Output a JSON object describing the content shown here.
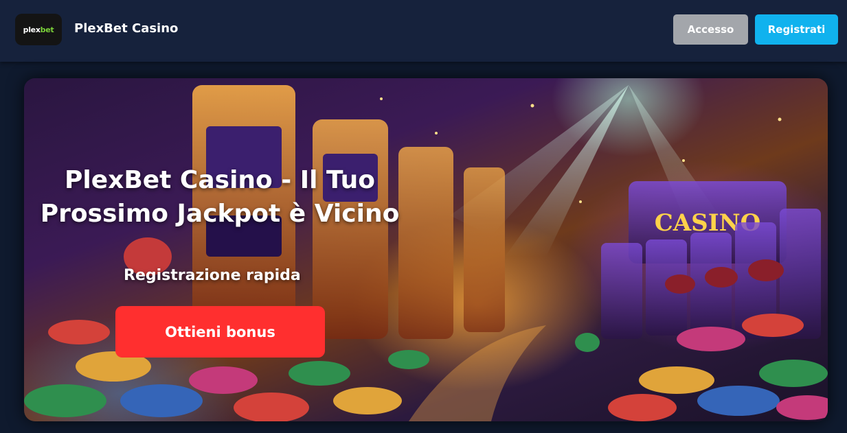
{
  "header": {
    "logo_text_a": "plex",
    "logo_text_b": "bet",
    "brand_name": "PlexBet Casino",
    "login_label": "Accesso",
    "register_label": "Registrati"
  },
  "hero": {
    "title": "PlexBet Casino - Il Tuo Prossimo Jackpot è Vicino",
    "subtitle": "Registrazione rapida",
    "cta_label": "Ottieni bonus",
    "image_lettering": "CASINO"
  },
  "colors": {
    "page_bg": "#0f1a2e",
    "header_bg": "#16223c",
    "login_bg": "#a3a6ab",
    "register_bg": "#10b2ee",
    "cta_bg": "#ff2f2f",
    "logo_accent": "#7bd23a"
  }
}
